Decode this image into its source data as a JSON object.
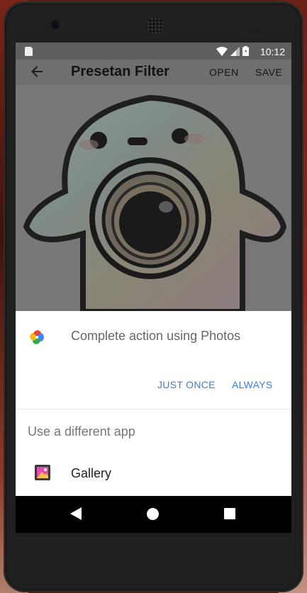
{
  "status_bar": {
    "time": "10:12"
  },
  "app_bar": {
    "title": "Presetan Filter",
    "actions": {
      "open": "OPEN",
      "save": "SAVE"
    }
  },
  "chooser": {
    "title": "Complete action using Photos",
    "just_once": "JUST ONCE",
    "always": "ALWAYS",
    "different_app_label": "Use a different app",
    "apps": [
      {
        "label": "Gallery",
        "icon": "gallery-icon"
      }
    ]
  },
  "colors": {
    "accent": "#3b7de0",
    "scrim_bar": "#5f5f5f",
    "sheet_bg": "#ffffff",
    "nav_bar": "#000000"
  }
}
